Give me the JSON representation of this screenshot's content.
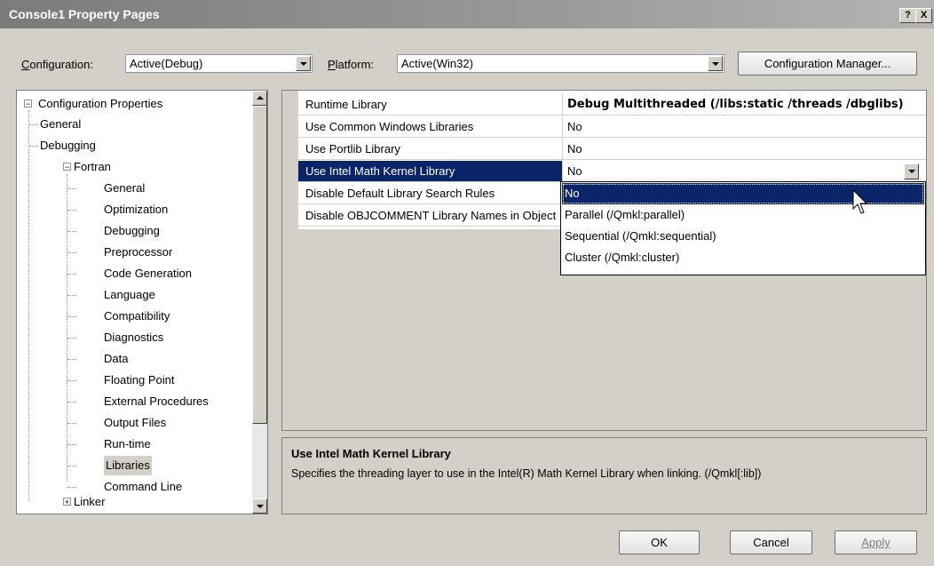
{
  "window": {
    "title": "Console1 Property Pages",
    "help_label": "?",
    "close_label": "X"
  },
  "toolbar": {
    "config_label_accel": "C",
    "config_label_rest": "onfiguration:",
    "config_value": "Active(Debug)",
    "platform_label_accel": "P",
    "platform_label_rest": "latform:",
    "platform_value": "Active(Win32)",
    "config_manager": "Configuration Manager..."
  },
  "tree": {
    "root": "Configuration Properties",
    "general": "General",
    "debugging": "Debugging",
    "fortran": "Fortran",
    "fortran_children": [
      "General",
      "Optimization",
      "Debugging",
      "Preprocessor",
      "Code Generation",
      "Language",
      "Compatibility",
      "Diagnostics",
      "Data",
      "Floating Point",
      "External Procedures",
      "Output Files",
      "Run-time",
      "Libraries",
      "Command Line"
    ],
    "linker": "Linker",
    "selected_index": 13
  },
  "grid": {
    "rows": [
      {
        "name": "Runtime Library",
        "value": "Debug Multithreaded (/libs:static /threads /dbglibs)",
        "bold": true
      },
      {
        "name": "Use Common Windows Libraries",
        "value": "No"
      },
      {
        "name": "Use Portlib Library",
        "value": "No"
      },
      {
        "name": "Use Intel Math Kernel Library",
        "value": "No",
        "selected": true
      },
      {
        "name": "Disable Default Library Search Rules",
        "value": ""
      },
      {
        "name": "Disable OBJCOMMENT Library Names in Object",
        "value": ""
      }
    ]
  },
  "dropdown": {
    "options": [
      "No",
      "Parallel (/Qmkl:parallel)",
      "Sequential (/Qmkl:sequential)",
      "Cluster (/Qmkl:cluster)"
    ],
    "highlighted": 0
  },
  "description": {
    "title": "Use Intel Math Kernel Library",
    "text": "Specifies the threading layer to use in the Intel(R) Math Kernel Library when linking. (/Qmkl[:lib])"
  },
  "buttons": {
    "ok": "OK",
    "cancel": "Cancel",
    "apply": "Apply"
  },
  "colors": {
    "selection": "#0a246a",
    "disabled_text": "#808080"
  }
}
